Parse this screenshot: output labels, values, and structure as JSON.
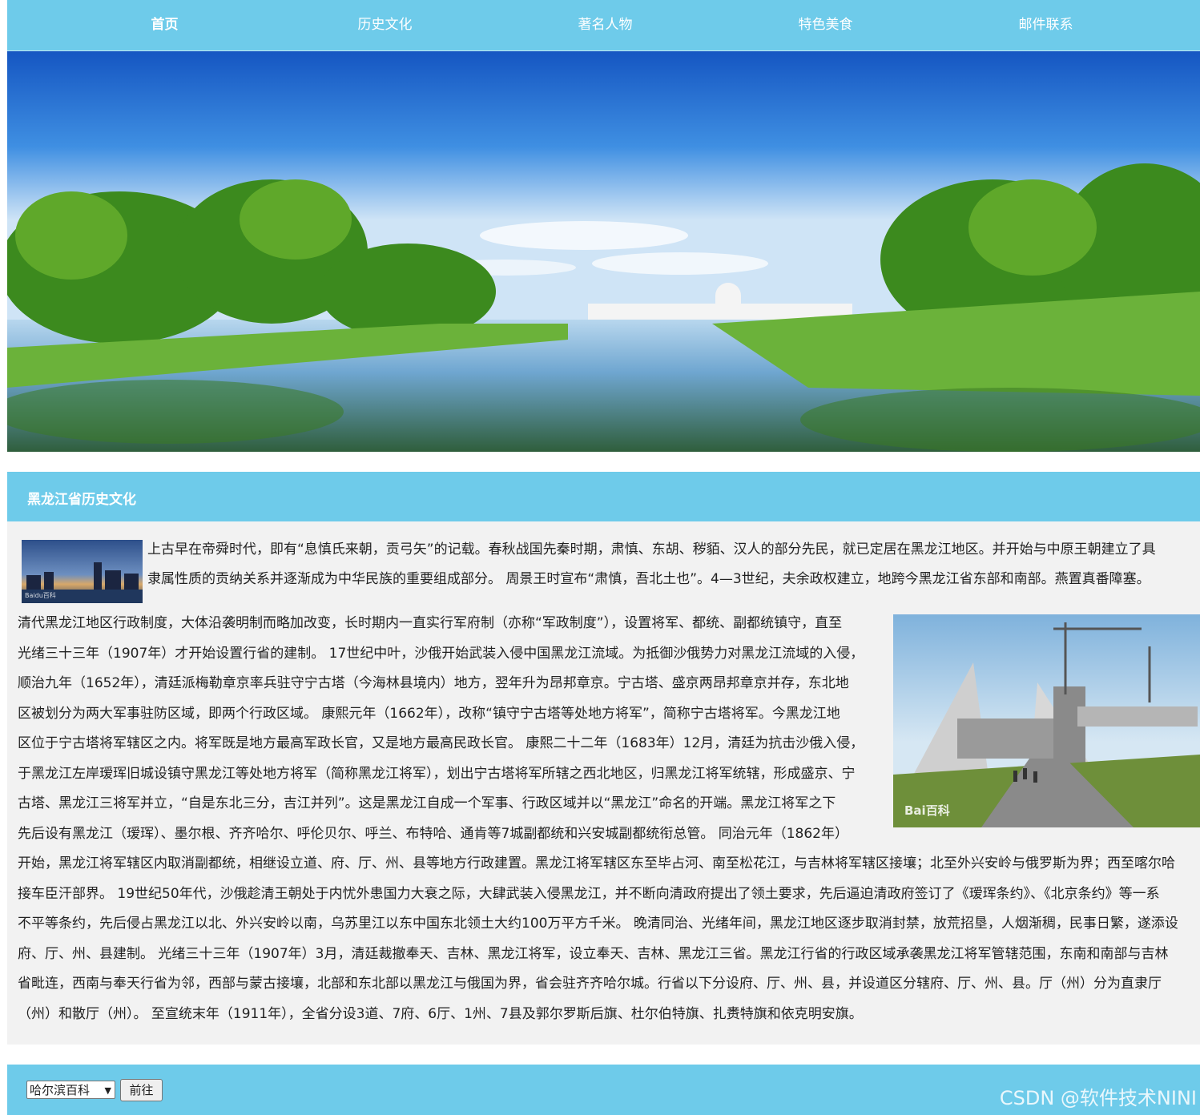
{
  "nav": {
    "items": [
      {
        "label": "首页",
        "active": true
      },
      {
        "label": "历史文化",
        "active": false
      },
      {
        "label": "著名人物",
        "active": false
      },
      {
        "label": "特色美食",
        "active": false
      },
      {
        "label": "邮件联系",
        "active": false
      }
    ]
  },
  "section": {
    "title": "黑龙江省历史文化"
  },
  "images": {
    "thumb_caption": "Baidu百科",
    "photo_caption": "Bai百科"
  },
  "paragraph1": {
    "lines": [
      "上古早在帝舜时代，即有“息慎氏来朝，贡弓矢”的记载。春秋战国先秦时期，肃慎、东胡、秽貊、汉人的部分先民，就已定居在黑龙江地区。并开始与中原王朝建立了具",
      "隶属性质的贡纳关系并逐渐成为中华民族的重要组成部分。 周景王时宣布“肃慎，吾北土也”。4—3世纪，夫余政权建立，地跨今黑龙江省东部和南部。燕置真番障塞。"
    ]
  },
  "paragraph2": {
    "lines": [
      "清代黑龙江地区行政制度，大体沿袭明制而略加改变，长时期内一直实行军府制（亦称“军政制度”），设置将军、都统、副都统镇守，直至",
      "光绪三十三年（1907年）才开始设置行省的建制。 17世纪中叶，沙俄开始武装入侵中国黑龙江流域。为抵御沙俄势力对黑龙江流域的入侵，",
      "顺治九年（1652年），清廷派梅勒章京率兵驻守宁古塔（今海林县境内）地方，翌年升为昂邦章京。宁古塔、盛京两昂邦章京并存，东北地",
      "区被划分为两大军事驻防区域，即两个行政区域。 康熙元年（1662年），改称“镇守宁古塔等处地方将军”，简称宁古塔将军。今黑龙江地",
      "区位于宁古塔将军辖区之内。将军既是地方最高军政长官，又是地方最高民政长官。 康熙二十二年（1683年）12月，清廷为抗击沙俄入侵，",
      "于黑龙江左岸瑷珲旧城设镇守黑龙江等处地方将军（简称黑龙江将军），划出宁古塔将军所辖之西北地区，归黑龙江将军统辖，形成盛京、宁",
      "古塔、黑龙江三将军并立，“自是东北三分，吉江并列”。这是黑龙江自成一个军事、行政区域并以“黑龙江”命名的开端。黑龙江将军之下",
      "先后设有黑龙江（瑷珲）、墨尔根、齐齐哈尔、呼伦贝尔、呼兰、布特哈、通肯等7城副都统和兴安城副都统衔总管。 同治元年（1862年）",
      "开始，黑龙江将军辖区内取消副都统，相继设立道、府、厅、州、县等地方行政建置。黑龙江将军辖区东至毕占河、南至松花江，与吉林将军辖区接壤；北至外兴安岭与俄罗斯为界；西至喀尔哈",
      "接车臣汗部界。 19世纪50年代，沙俄趁清王朝处于内忧外患国力大衰之际，大肆武装入侵黑龙江，并不断向清政府提出了领土要求，先后逼迫清政府签订了《瑷珲条约》、《北京条约》等一系",
      "不平等条约，先后侵占黑龙江以北、外兴安岭以南，乌苏里江以东中国东北领土大约100万平方千米。 晚清同治、光绪年间，黑龙江地区逐步取消封禁，放荒招垦，人烟渐稠，民事日繁，遂添设",
      "府、厅、州、县建制。 光绪三十三年（1907年）3月，清廷裁撤奉天、吉林、黑龙江将军，设立奉天、吉林、黑龙江三省。黑龙江行省的行政区域承袭黑龙江将军管辖范围，东南和南部与吉林",
      "省毗连，西南与奉天行省为邻，西部与蒙古接壤，北部和东北部以黑龙江与俄国为界，省会驻齐齐哈尔城。行省以下分设府、厅、州、县，并设道区分辖府、厅、州、县。厅（州）分为直隶厅",
      "（州）和散厅（州）。 至宣统末年（1911年），全省分设3道、7府、6厅、1州、7县及郭尔罗斯后旗、杜尔伯特旗、扎赉特旗和依克明安旗。"
    ]
  },
  "footer": {
    "select_value": "哈尔滨百科",
    "go_button": "前往",
    "watermark": "CSDN @软件技术NINI"
  },
  "colors": {
    "nav_bg": "#6ecbea",
    "content_bg": "#f2f2f2"
  }
}
